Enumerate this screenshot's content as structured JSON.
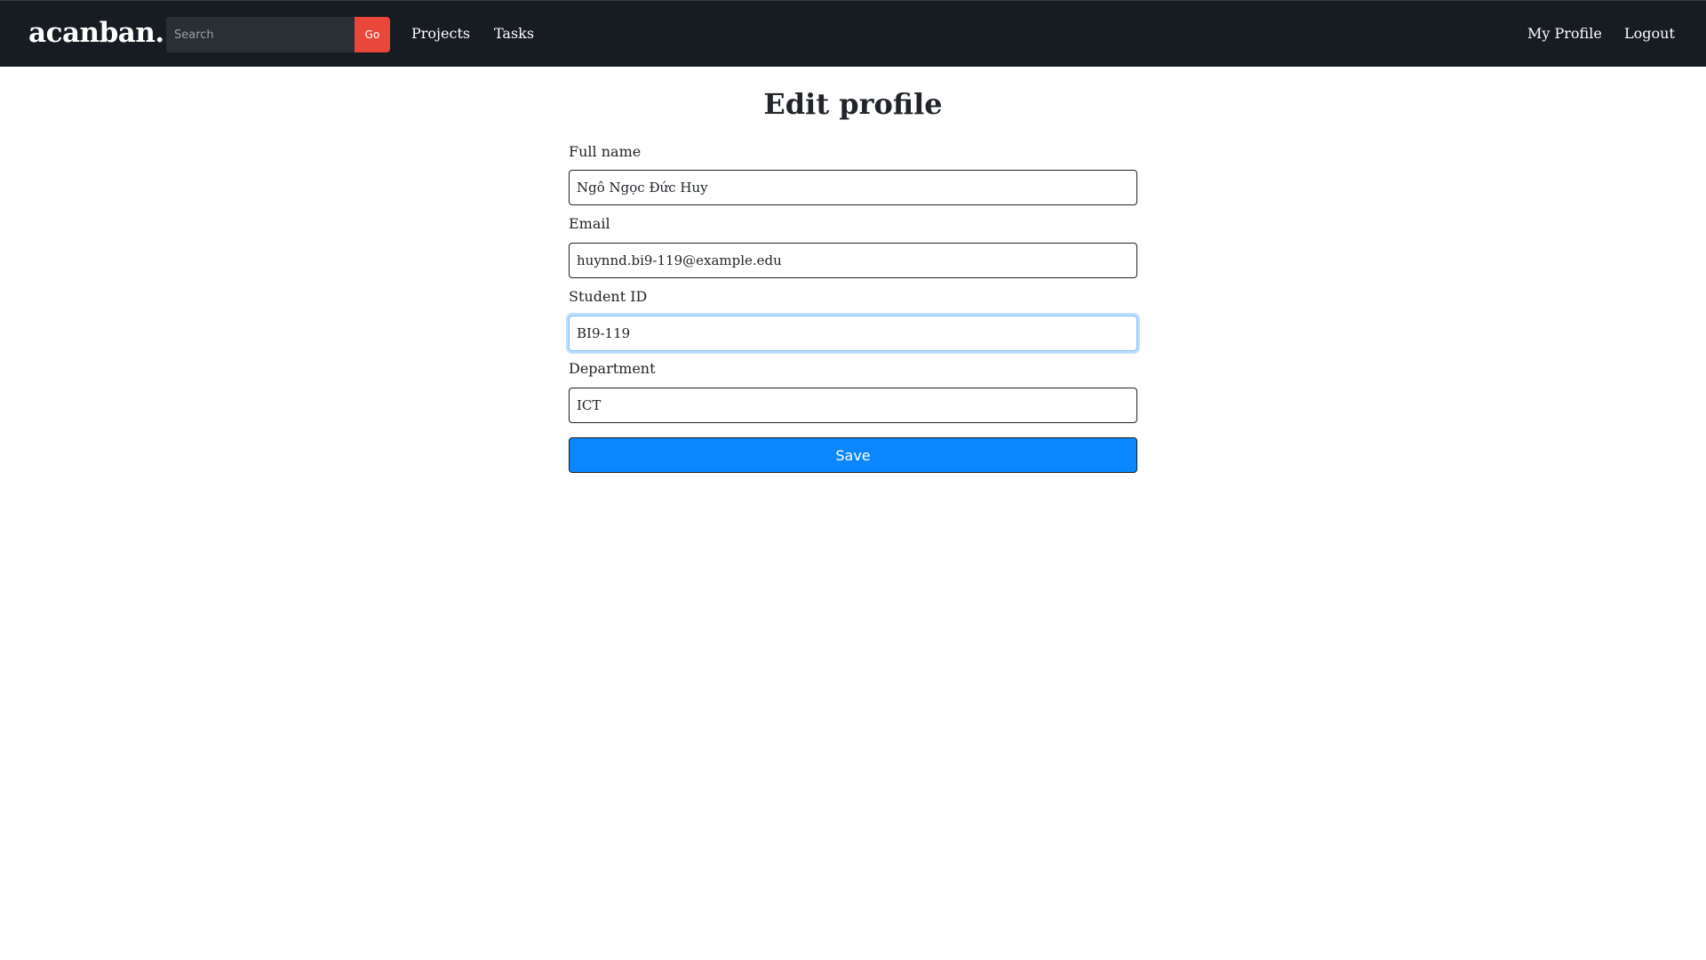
{
  "nav": {
    "brand": "acanban.",
    "search_placeholder": "Search",
    "go_label": "Go",
    "links": [
      "Projects",
      "Tasks"
    ],
    "right_links": [
      "My Profile",
      "Logout"
    ]
  },
  "main": {
    "title": "Edit profile",
    "fields": [
      {
        "label": "Full name",
        "value": "Ngô Ngọc Đức Huy"
      },
      {
        "label": "Email",
        "value": "huynnd.bi9-119@example.edu"
      },
      {
        "label": "Student ID",
        "value": "BI9-119"
      },
      {
        "label": "Department",
        "value": "ICT"
      }
    ],
    "save_label": "Save"
  },
  "colors": {
    "navbar_bg": "#171b22",
    "search_bg": "#2a2e35",
    "go_button": "#e9473a",
    "save_button": "#0a87ff",
    "focus_ring": "#80bdff"
  }
}
